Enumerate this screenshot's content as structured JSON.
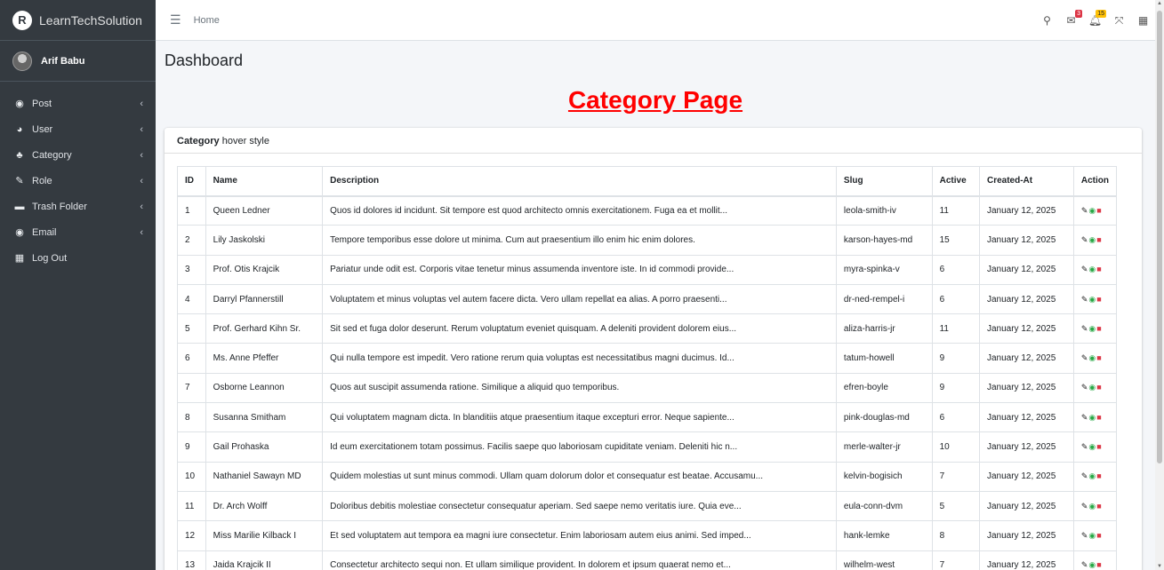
{
  "brand": {
    "logo_letter": "R",
    "name": "LearnTechSolution"
  },
  "user": {
    "name": "Arif Babu"
  },
  "sidebar": {
    "items": [
      {
        "label": "Post",
        "icon": "dashboard-icon",
        "glyph": "◉"
      },
      {
        "label": "User",
        "icon": "pie-chart-icon",
        "glyph": "◕"
      },
      {
        "label": "Category",
        "icon": "tree-icon",
        "glyph": "♣"
      },
      {
        "label": "Role",
        "icon": "edit-icon",
        "glyph": "✎"
      },
      {
        "label": "Trash Folder",
        "icon": "trash-folder-icon",
        "glyph": "▬"
      },
      {
        "label": "Email",
        "icon": "email-icon",
        "glyph": "◉"
      },
      {
        "label": "Log Out",
        "icon": "grid-icon",
        "glyph": "▦"
      }
    ]
  },
  "topbar": {
    "home_label": "Home",
    "messages_badge": "3",
    "notifications_badge": "15"
  },
  "content": {
    "header": "Dashboard",
    "heading": "Category Page",
    "card_title_bold": "Category",
    "card_title_rest": " hover style"
  },
  "table": {
    "columns": [
      "ID",
      "Name",
      "Description",
      "Slug",
      "Active",
      "Created-At",
      "Action"
    ],
    "rows": [
      [
        "1",
        "Queen Ledner",
        "Quos id dolores id incidunt. Sit tempore est quod architecto omnis exercitationem. Fuga ea et mollit...",
        "leola-smith-iv",
        "11",
        "January 12, 2025"
      ],
      [
        "2",
        "Lily Jaskolski",
        "Tempore temporibus esse dolore ut minima. Cum aut praesentium illo enim hic enim dolores.",
        "karson-hayes-md",
        "15",
        "January 12, 2025"
      ],
      [
        "3",
        "Prof. Otis Krajcik",
        "Pariatur unde odit est. Corporis vitae tenetur minus assumenda inventore iste. In id commodi provide...",
        "myra-spinka-v",
        "6",
        "January 12, 2025"
      ],
      [
        "4",
        "Darryl Pfannerstill",
        "Voluptatem et minus voluptas vel autem facere dicta. Vero ullam repellat ea alias. A porro praesenti...",
        "dr-ned-rempel-i",
        "6",
        "January 12, 2025"
      ],
      [
        "5",
        "Prof. Gerhard Kihn Sr.",
        "Sit sed et fuga dolor deserunt. Rerum voluptatum eveniet quisquam. A deleniti provident dolorem eius...",
        "aliza-harris-jr",
        "11",
        "January 12, 2025"
      ],
      [
        "6",
        "Ms. Anne Pfeffer",
        "Qui nulla tempore est impedit. Vero ratione rerum quia voluptas est necessitatibus magni ducimus. Id...",
        "tatum-howell",
        "9",
        "January 12, 2025"
      ],
      [
        "7",
        "Osborne Leannon",
        "Quos aut suscipit assumenda ratione. Similique a aliquid quo temporibus.",
        "efren-boyle",
        "9",
        "January 12, 2025"
      ],
      [
        "8",
        "Susanna Smitham",
        "Qui voluptatem magnam dicta. In blanditiis atque praesentium itaque excepturi error. Neque sapiente...",
        "pink-douglas-md",
        "6",
        "January 12, 2025"
      ],
      [
        "9",
        "Gail Prohaska",
        "Id eum exercitationem totam possimus. Facilis saepe quo laboriosam cupiditate veniam. Deleniti hic n...",
        "merle-walter-jr",
        "10",
        "January 12, 2025"
      ],
      [
        "10",
        "Nathaniel Sawayn MD",
        "Quidem molestias ut sunt minus commodi. Ullam quam dolorum dolor et consequatur est beatae. Accusamu...",
        "kelvin-bogisich",
        "7",
        "January 12, 2025"
      ],
      [
        "11",
        "Dr. Arch Wolff",
        "Doloribus debitis molestiae consectetur consequatur aperiam. Sed saepe nemo veritatis iure. Quia eve...",
        "eula-conn-dvm",
        "5",
        "January 12, 2025"
      ],
      [
        "12",
        "Miss Marilie Kilback I",
        "Et sed voluptatem aut tempora ea magni iure consectetur. Enim laboriosam autem eius animi. Sed imped...",
        "hank-lemke",
        "8",
        "January 12, 2025"
      ],
      [
        "13",
        "Jaida Krajcik II",
        "Consectetur architecto sequi non. Et ullam similique provident. In dolorem et ipsum quaerat nemo et...",
        "wilhelm-west",
        "7",
        "January 12, 2025"
      ]
    ],
    "action_icons": [
      "edit-icon",
      "view-icon",
      "delete-icon"
    ]
  },
  "colors": {
    "sidebar_bg": "#343a40",
    "heading": "#ff0000",
    "view": "#28a745",
    "delete": "#dc3545"
  }
}
